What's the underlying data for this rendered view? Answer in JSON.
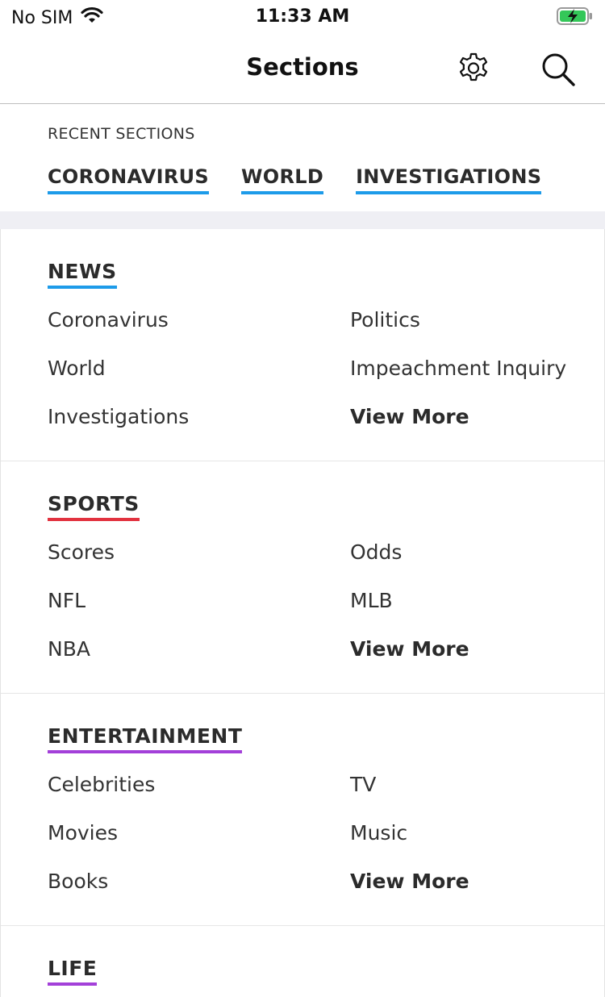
{
  "status_bar": {
    "carrier": "No SIM",
    "time": "11:33 AM"
  },
  "nav": {
    "title": "Sections",
    "settings_icon": "gear-icon",
    "search_icon": "search-icon"
  },
  "recent": {
    "label": "RECENT SECTIONS",
    "links": [
      "CORONAVIRUS",
      "WORLD",
      "INVESTIGATIONS"
    ],
    "accent": "#1d9be9"
  },
  "sections": [
    {
      "title": "NEWS",
      "accent": "#1d9be9",
      "links": [
        "Coronavirus",
        "Politics",
        "World",
        "Impeachment Inquiry",
        "Investigations",
        "View More"
      ]
    },
    {
      "title": "SPORTS",
      "accent": "#e2323f",
      "links": [
        "Scores",
        "Odds",
        "NFL",
        "MLB",
        "NBA",
        "View More"
      ]
    },
    {
      "title": "ENTERTAINMENT",
      "accent": "#a340d9",
      "links": [
        "Celebrities",
        "TV",
        "Movies",
        "Music",
        "Books",
        "View More"
      ]
    },
    {
      "title": "LIFE",
      "accent": "#a340d9",
      "links": []
    }
  ]
}
